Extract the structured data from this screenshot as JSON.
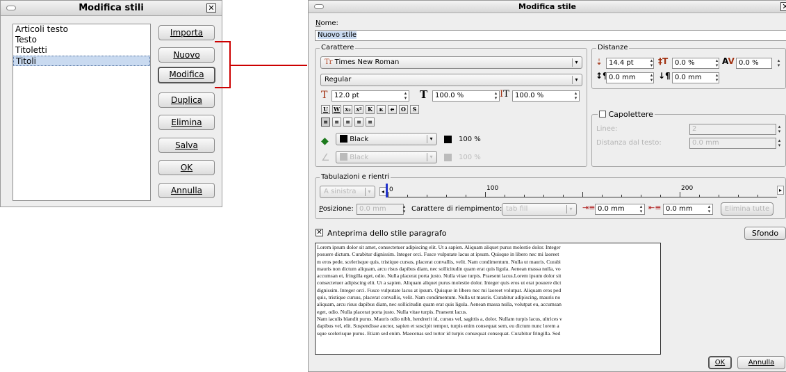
{
  "left_dialog": {
    "title": "Modifica stili",
    "styles": [
      "Articoli testo",
      "Testo",
      "Titoletti",
      "Titoli"
    ],
    "buttons": {
      "importa": "Importa",
      "nuovo": "Nuovo",
      "modifica": "Modifica",
      "duplica": "Duplica",
      "elimina": "Elimina",
      "salva": "Salva",
      "ok": "OK",
      "annulla": "Annulla"
    }
  },
  "right_dialog": {
    "title": "Modifica stile",
    "name_label": "Nome:",
    "name_value": "Nuovo stile",
    "carattere": {
      "title": "Carattere",
      "font": "Times New Roman",
      "style": "Regular",
      "size": "12.0 pt",
      "scale_h": "100.0 %",
      "scale_v": "100.0 %",
      "fill_color": "Black",
      "fill_shade": "100 %",
      "stroke_color": "Black",
      "stroke_shade": "100 %"
    },
    "distanze": {
      "title": "Distanze",
      "line_spacing": "14.4 pt",
      "baseline_offset": "0.0 %",
      "tracking": "0.0 %",
      "space_before": "0.0 mm",
      "space_after": "0.0 mm"
    },
    "capolettere": {
      "title": "Capolettere",
      "lines_label": "Linee:",
      "lines_value": "2",
      "distance_label": "Distanza dal testo:",
      "distance_value": "0.0 mm"
    },
    "tabulazioni": {
      "title": "Tabulazioni e rientri",
      "alignment": "A sinistra",
      "ruler_labels": [
        "0",
        "100",
        "200"
      ],
      "position_label": "Posizione:",
      "position_value": "0.0 mm",
      "fill_label": "Carattere di riempimento:",
      "fill_value": "tab fill",
      "indent_first": "0.0 mm",
      "indent_left": "0.0 mm",
      "delete_all": "Elimina tutte"
    },
    "preview_label": "Anteprima dello stile paragrafo",
    "background_button": "Sfondo",
    "preview_lines": [
      "Lorem ipsum dolor sit amet, consectetuer adipiscing elit. Ut a sapien. Aliquam aliquet purus molestie dolor. Integer",
      " posuere dictum. Curabitur dignissim. Integer orci. Fusce vulputate lacus at ipsum. Quisque in libero nec mi laoreet",
      "m eros pede, scelerisque quis, tristique cursus, placerat convallis, velit. Nam condimentum. Nulla ut mauris. Curabi",
      "mauris non dictum aliquam, arcu risus dapibus diam, nec sollicitudin quam erat quis ligula. Aenean massa nulla, vo",
      "accumsan et, fringilla eget, odio. Nulla placerat porta justo. Nulla vitae turpis. Praesent lacus.Lorem ipsum dolor sit",
      "consectetuer adipiscing elit. Ut a sapien. Aliquam aliquet purus molestie dolor. Integer quis eros ut erat posuere dict",
      "dignissim. Integer orci. Fusce vulputate lacus at ipsum. Quisque in libero nec mi laoreet volutpat. Aliquam eros ped",
      "quis, tristique cursus, placerat convallis, velit. Nam condimentum. Nulla ut mauris. Curabitur adipiscing, mauris no",
      "aliquam, arcu risus dapibus diam, nec sollicitudin quam erat quis ligula. Aenean massa nulla, volutpat eu, accumsan",
      "eget, odio. Nulla placerat porta justo. Nulla vitae turpis. Praesent lacus.",
      "Nam iaculis blandit purus. Mauris odio nibh, hendrerit id, cursus vel, sagittis a, dolor. Nullam turpis lacus, ultrices v",
      " dapibus vel, elit. Suspendisse auctor, sapien et suscipit tempor, turpis enim consequat sem, eu dictum nunc lorem a",
      "sque scelerisque purus. Etiam sed enim. Maecenas sed tortor id turpis consequat consequat. Curabitur fringilla. Sed"
    ],
    "ok_label": "OK",
    "cancel_label": "Annulla"
  },
  "colors": {
    "connector": "#cc0000",
    "selection": "#c9daf0",
    "name_highlight": "#c9daf0"
  }
}
